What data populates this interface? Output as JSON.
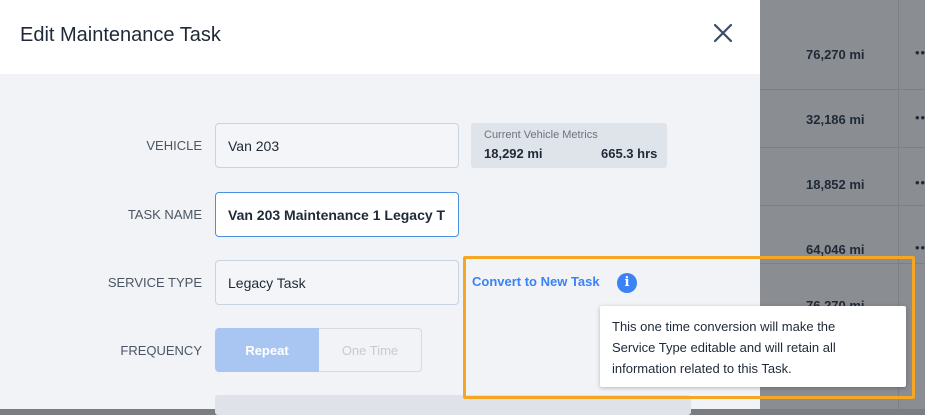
{
  "background_table": {
    "mileages": [
      "76,270 mi",
      "32,186 mi",
      "18,852 mi",
      "64,046 mi",
      "76,270 mi"
    ]
  },
  "modal": {
    "title": "Edit Maintenance Task",
    "close_icon": "close-icon",
    "vehicle": {
      "label": "VEHICLE",
      "value": "Van 203"
    },
    "metrics": {
      "title": "Current Vehicle Metrics",
      "miles": "18,292 mi",
      "hours": "665.3 hrs"
    },
    "task_name": {
      "label": "TASK NAME",
      "value": "Van 203 Maintenance 1 Legacy T"
    },
    "service_type": {
      "label": "SERVICE TYPE",
      "value": "Legacy Task"
    },
    "convert_link": "Convert to New Task",
    "info_icon": "info-icon",
    "frequency": {
      "label": "FREQUENCY",
      "options": [
        "Repeat",
        "One Time"
      ],
      "selected": "Repeat"
    }
  },
  "tooltip": {
    "lines": [
      "This one time conversion will make the",
      "Service Type editable and will retain all",
      "information related to this Task."
    ]
  },
  "colors": {
    "accent": "#3b82f6",
    "highlight": "#f5a623",
    "overlay": "#7a7d82"
  }
}
